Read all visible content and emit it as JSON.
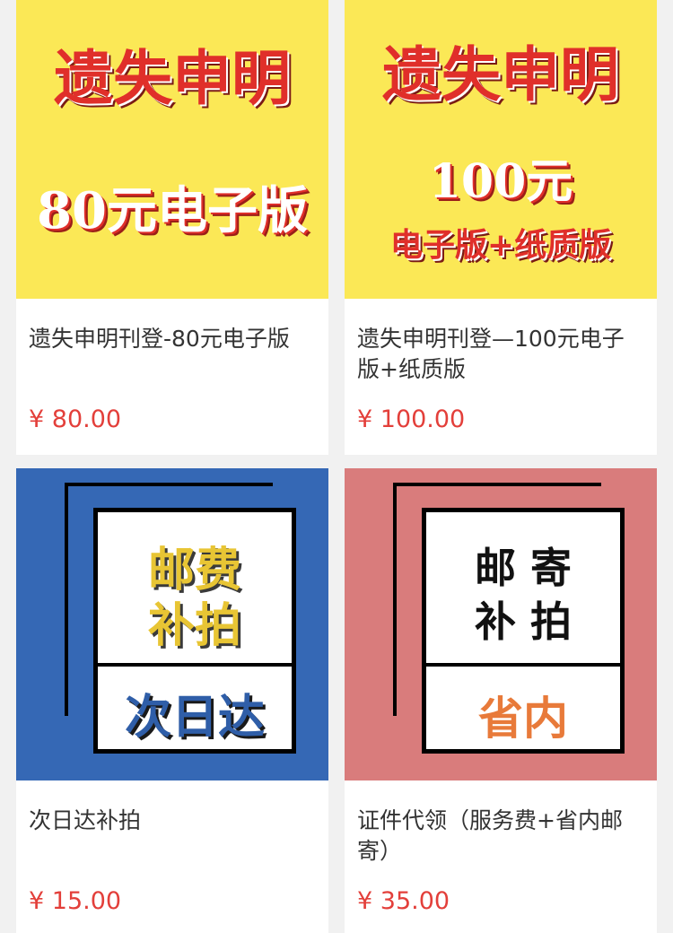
{
  "products": [
    {
      "image": {
        "style": "yellow",
        "lines": [
          "遗失申明",
          "80元电子版"
        ]
      },
      "title": "遗失申明刊登-80元电子版",
      "price": "¥ 80.00"
    },
    {
      "image": {
        "style": "yellow",
        "lines": [
          "遗失申明",
          "100元",
          "电子版+纸质版"
        ]
      },
      "title": "遗失申明刊登—100元电子版+纸质版",
      "price": "¥ 100.00"
    },
    {
      "image": {
        "style": "blue",
        "lines": [
          "邮费",
          "补拍",
          "次日达"
        ]
      },
      "title": "次日达补拍",
      "price": "¥ 15.00"
    },
    {
      "image": {
        "style": "pink",
        "lines": [
          "邮 寄",
          "补 拍",
          "省内"
        ]
      },
      "title": "证件代领（服务费+省内邮寄）",
      "price": "¥ 35.00"
    }
  ],
  "colors": {
    "background": "#f1f1f1",
    "price": "#e33f3a",
    "banner_yellow": "#fbe856",
    "banner_red": "#e02f2a",
    "tile_blue": "#3568b5",
    "tile_pink": "#d97c7c",
    "tile_gold": "#e8c534",
    "tile_orange": "#e87a3a"
  }
}
